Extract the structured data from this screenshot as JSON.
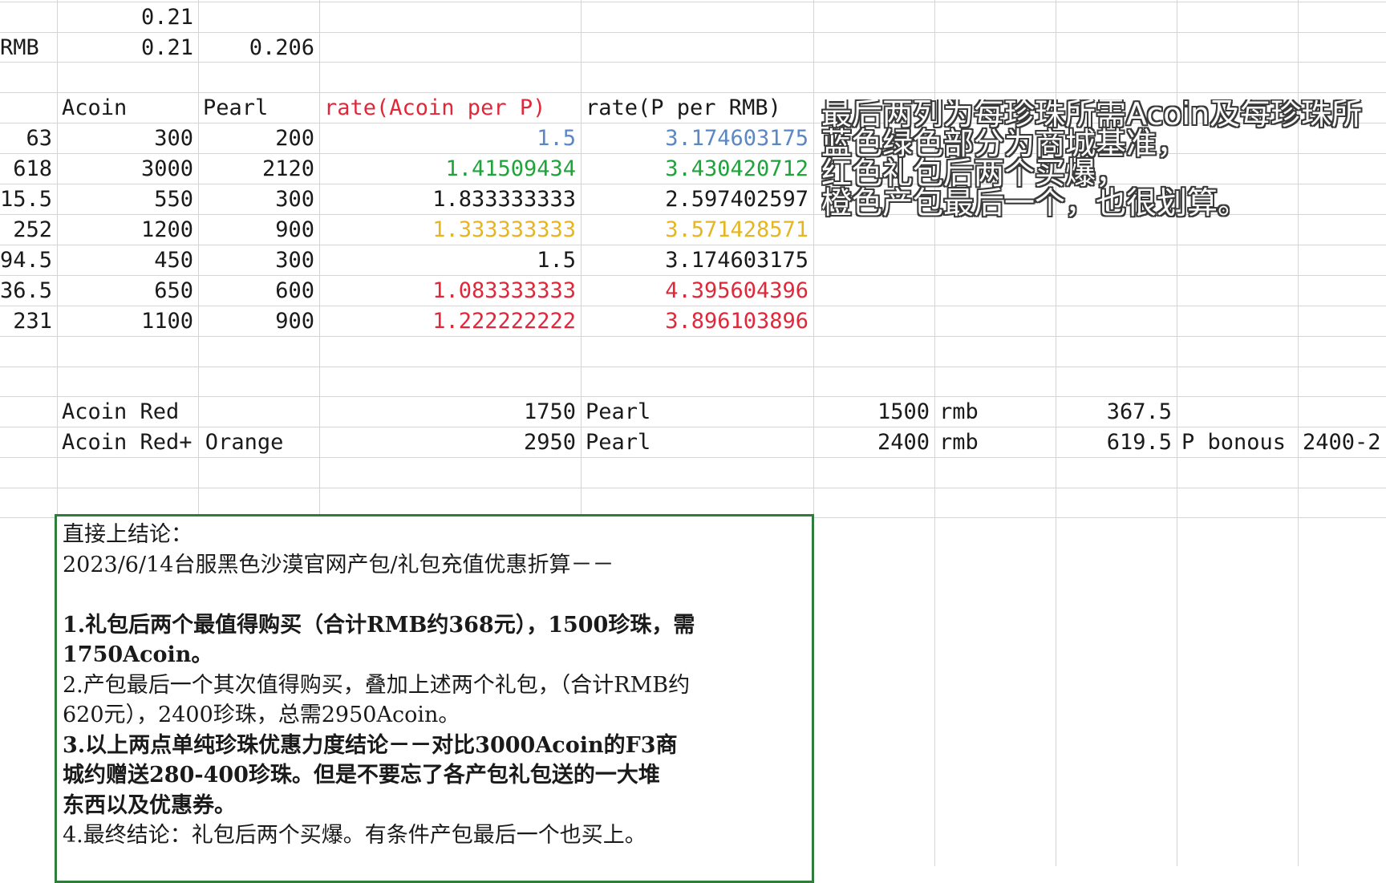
{
  "sheet": {
    "top_rows": [
      {
        "b": "",
        "c": "0.21",
        "d": ""
      },
      {
        "b": "RMB",
        "c": "0.21",
        "d": "0.206"
      }
    ],
    "headers": {
      "a": "Acoin",
      "b": "Pearl",
      "c": "rate(Acoin per P)",
      "d": "rate(P per RMB)"
    },
    "rows": [
      {
        "rmb": "63",
        "acoin": "300",
        "pearl": "200",
        "rate_a": "1.5",
        "rate_p": "3.174603175",
        "color": "blue"
      },
      {
        "rmb": "618",
        "acoin": "3000",
        "pearl": "2120",
        "rate_a": "1.41509434",
        "rate_p": "3.430420712",
        "color": "green"
      },
      {
        "rmb": "15.5",
        "acoin": "550",
        "pearl": "300",
        "rate_a": "1.833333333",
        "rate_p": "2.597402597",
        "color": "none"
      },
      {
        "rmb": "252",
        "acoin": "1200",
        "pearl": "900",
        "rate_a": "1.333333333",
        "rate_p": "3.571428571",
        "color": "yellow"
      },
      {
        "rmb": "94.5",
        "acoin": "450",
        "pearl": "300",
        "rate_a": "1.5",
        "rate_p": "3.174603175",
        "color": "none"
      },
      {
        "rmb": "36.5",
        "acoin": "650",
        "pearl": "600",
        "rate_a": "1.083333333",
        "rate_p": "4.395604396",
        "color": "red"
      },
      {
        "rmb": "231",
        "acoin": "1100",
        "pearl": "900",
        "rate_a": "1.222222222",
        "rate_p": "3.896103896",
        "color": "red"
      }
    ],
    "summary": [
      {
        "label": "Acoin Red",
        "acoin": "1750",
        "pearl_label": "Pearl",
        "pearl": "1500",
        "rmb_label": "rmb",
        "rmb": "367.5",
        "extra1": "",
        "extra2": ""
      },
      {
        "label": "Acoin Red+ Orange",
        "acoin": "2950",
        "pearl_label": "Pearl",
        "pearl": "2400",
        "rmb_label": "rmb",
        "rmb": "619.5",
        "extra1": "P bonous",
        "extra2": "2400-2"
      }
    ]
  },
  "overlay_note": [
    "最后两列为每珍珠所需Acoin及每珍珠所",
    "蓝色绿色部分为商城基准，",
    "红色礼包后两个买爆，",
    "橙色产包最后一个，也很划算。"
  ],
  "conclusion": {
    "title": "直接上结论：",
    "subtitle": "2023/6/14台服黑色沙漠官网产包/礼包充值优惠折算－－",
    "p1a": "1.礼包后两个最值得购买（合计RMB约368元），1500珍珠，需",
    "p1b": "1750Acoin。",
    "p2a": "2.产包最后一个其次值得购买，叠加上述两个礼包，（合计RMB约",
    "p2b": "620元），2400珍珠，总需2950Acoin。",
    "p3a": "3.以上两点单纯珍珠优惠力度结论－－对比3000Acoin的F3商",
    "p3b": "城约赠送280-400珍珠。但是不要忘了各产包礼包送的一大堆",
    "p3c": "东西以及优惠券。",
    "p4": "4.最终结论：礼包后两个买爆。有条件产包最后一个也买上。"
  },
  "colors": {
    "blue": "#5b87c4",
    "green": "#1fa33a",
    "yellow": "#e6b620",
    "red": "#e0283a",
    "border": "#2e7d3b"
  }
}
